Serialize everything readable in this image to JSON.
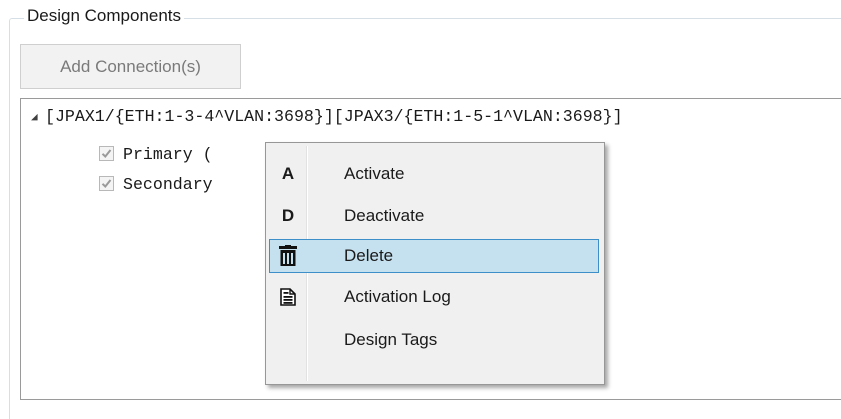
{
  "group": {
    "title": "Design Components"
  },
  "toolbar": {
    "add_connection_label": "Add Connection(s)"
  },
  "tree": {
    "root": {
      "expander": "◢",
      "label": "[JPAX1/{ETH:1-3-4^VLAN:3698}][JPAX3/{ETH:1-5-1^VLAN:3698}]",
      "children": [
        {
          "label": "Primary (",
          "checked": true
        },
        {
          "label": "Secondary",
          "checked": true
        }
      ]
    }
  },
  "context_menu": {
    "items": [
      {
        "icon_text": "A",
        "icon": "letter-a-icon",
        "label": "Activate"
      },
      {
        "icon_text": "D",
        "icon": "letter-d-icon",
        "label": "Deactivate"
      },
      {
        "icon": "trash-icon",
        "label": "Delete",
        "highlighted": true
      },
      {
        "icon": "log-document-icon",
        "label": "Activation Log"
      },
      {
        "icon": "",
        "label": "Design Tags"
      }
    ]
  },
  "colors": {
    "menu_highlight_bg": "#c5e1ef",
    "menu_highlight_border": "#3c8fc8",
    "menu_bg": "#f0f0f0",
    "group_border": "#d5dfe5"
  }
}
